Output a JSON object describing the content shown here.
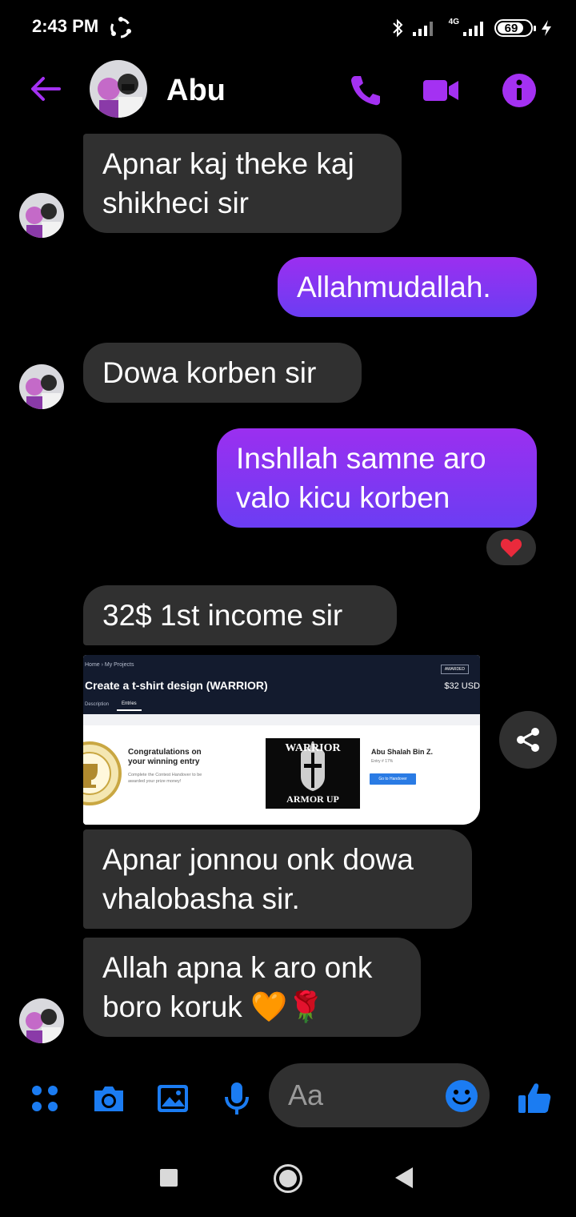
{
  "status_bar": {
    "time": "2:43 PM",
    "network": "4G",
    "battery": "69"
  },
  "header": {
    "contact_name": "Abu",
    "accent_color": "#a431f2"
  },
  "messages": [
    {
      "side": "incoming",
      "text": "Apnar kaj theke kaj shikheci sir"
    },
    {
      "side": "outgoing",
      "text": "Allahmudallah."
    },
    {
      "side": "incoming",
      "text": "Dowa korben sir"
    },
    {
      "side": "outgoing",
      "text": "Inshllah samne aro valo kicu korben",
      "reaction": "❤️"
    },
    {
      "side": "incoming",
      "text": "32$ 1st income sir"
    },
    {
      "side": "incoming",
      "text": "Apnar jonnou onk dowa vhalobasha sir."
    },
    {
      "side": "incoming",
      "text": "Allah apna k aro onk boro koruk 🧡🌹"
    }
  ],
  "shared_image": {
    "breadcrumb": "Home › My Projects",
    "awarded_badge": "AWARDED",
    "title": "Create a t-shirt design (WARRIOR)",
    "price": "$32 USD",
    "tab_description": "Description",
    "tab_entries": "Entries",
    "congrats_title": "Congratulations on your winning entry",
    "congrats_text": "Complete the Contest Handover to be awarded your prize money!",
    "poster_top": "WARRIOR",
    "poster_bottom": "ARMOR UP",
    "winner_name": "Abu Shalah Bin Z.",
    "entry_number": "Entry # 17%",
    "handover_button": "Go to Handover"
  },
  "composer": {
    "placeholder": "Aa",
    "icon_color": "#1b7cf2"
  }
}
